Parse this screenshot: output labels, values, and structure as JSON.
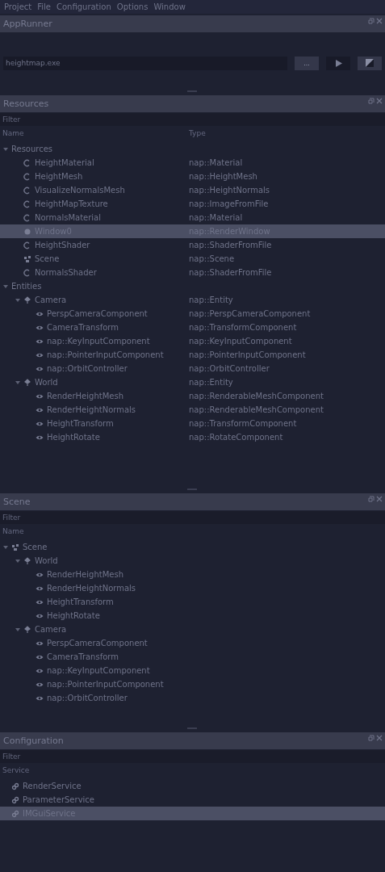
{
  "menu": [
    "Project",
    "File",
    "Configuration",
    "Options",
    "Window"
  ],
  "app_runner": {
    "title": "AppRunner",
    "path": "heightmap.exe",
    "browse_label": "...",
    "buttons": [
      {
        "kind": "play"
      },
      {
        "kind": "stop"
      }
    ]
  },
  "resources": {
    "title": "Resources",
    "filter": {
      "placeholder": "Filter"
    },
    "columns": [
      "Name",
      "Type"
    ],
    "tree": [
      {
        "name": "Resources",
        "expanded": true,
        "selected": false,
        "children": [
          {
            "name": "HeightMaterial",
            "type": "nap::Material",
            "kind": "resource",
            "selected": false
          },
          {
            "name": "HeightMesh",
            "type": "nap::HeightMesh",
            "kind": "resource",
            "selected": false
          },
          {
            "name": "VisualizeNormalsMesh",
            "type": "nap::HeightNormals",
            "kind": "resource",
            "selected": false
          },
          {
            "name": "HeightMapTexture",
            "type": "nap::ImageFromFile",
            "kind": "resource",
            "selected": false
          },
          {
            "name": "NormalsMaterial",
            "type": "nap::Material",
            "kind": "resource",
            "selected": false
          },
          {
            "name": "Window0",
            "type": "nap::RenderWindow",
            "kind": "window",
            "selected": true
          },
          {
            "name": "HeightShader",
            "type": "nap::ShaderFromFile",
            "kind": "resource",
            "selected": false
          },
          {
            "name": "Scene",
            "type": "nap::Scene",
            "kind": "scene",
            "selected": false
          },
          {
            "name": "NormalsShader",
            "type": "nap::ShaderFromFile",
            "kind": "resource",
            "selected": false
          }
        ]
      },
      {
        "name": "Entities",
        "expanded": true,
        "selected": false,
        "children": [
          {
            "name": "Camera",
            "type": "nap::Entity",
            "kind": "entity",
            "expanded": true,
            "selected": false,
            "children": [
              {
                "name": "PerspCameraComponent",
                "type": "nap::PerspCameraComponent",
                "kind": "component",
                "selected": false
              },
              {
                "name": "CameraTransform",
                "type": "nap::TransformComponent",
                "kind": "component",
                "selected": false
              },
              {
                "name": "nap::KeyInputComponent",
                "type": "nap::KeyInputComponent",
                "kind": "component",
                "selected": false
              },
              {
                "name": "nap::PointerInputComponent",
                "type": "nap::PointerInputComponent",
                "kind": "component",
                "selected": false
              },
              {
                "name": "nap::OrbitController",
                "type": "nap::OrbitController",
                "kind": "component",
                "selected": false
              }
            ]
          },
          {
            "name": "World",
            "type": "nap::Entity",
            "kind": "entity",
            "expanded": true,
            "selected": false,
            "children": [
              {
                "name": "RenderHeightMesh",
                "type": "nap::RenderableMeshComponent",
                "kind": "component",
                "selected": false
              },
              {
                "name": "RenderHeightNormals",
                "type": "nap::RenderableMeshComponent",
                "kind": "component",
                "selected": false
              },
              {
                "name": "HeightTransform",
                "type": "nap::TransformComponent",
                "kind": "component",
                "selected": false
              },
              {
                "name": "HeightRotate",
                "type": "nap::RotateComponent",
                "kind": "component",
                "selected": false
              }
            ]
          }
        ]
      }
    ]
  },
  "scene": {
    "title": "Scene",
    "filter": {
      "placeholder": "Filter"
    },
    "columns": [
      "Name"
    ],
    "tree": [
      {
        "name": "Scene",
        "kind": "scene",
        "expanded": true,
        "selected": false,
        "children": [
          {
            "name": "World",
            "kind": "entity",
            "expanded": true,
            "selected": false,
            "children": [
              {
                "name": "RenderHeightMesh",
                "kind": "component",
                "selected": false
              },
              {
                "name": "RenderHeightNormals",
                "kind": "component",
                "selected": false
              },
              {
                "name": "HeightTransform",
                "kind": "component",
                "selected": false
              },
              {
                "name": "HeightRotate",
                "kind": "component",
                "selected": false
              }
            ]
          },
          {
            "name": "Camera",
            "kind": "entity",
            "expanded": true,
            "selected": false,
            "children": [
              {
                "name": "PerspCameraComponent",
                "kind": "component",
                "selected": false
              },
              {
                "name": "CameraTransform",
                "kind": "component",
                "selected": false
              },
              {
                "name": "nap::KeyInputComponent",
                "kind": "component",
                "selected": false
              },
              {
                "name": "nap::PointerInputComponent",
                "kind": "component",
                "selected": false
              },
              {
                "name": "nap::OrbitController",
                "kind": "component",
                "selected": false
              }
            ]
          }
        ]
      }
    ]
  },
  "configuration": {
    "title": "Configuration",
    "filter": {
      "placeholder": "Filter"
    },
    "columns": [
      "Service"
    ],
    "tree": [
      {
        "name": "RenderService",
        "kind": "service",
        "selected": false
      },
      {
        "name": "ParameterService",
        "kind": "service",
        "selected": false
      },
      {
        "name": "IMGuiService",
        "kind": "service",
        "selected": true
      }
    ]
  }
}
